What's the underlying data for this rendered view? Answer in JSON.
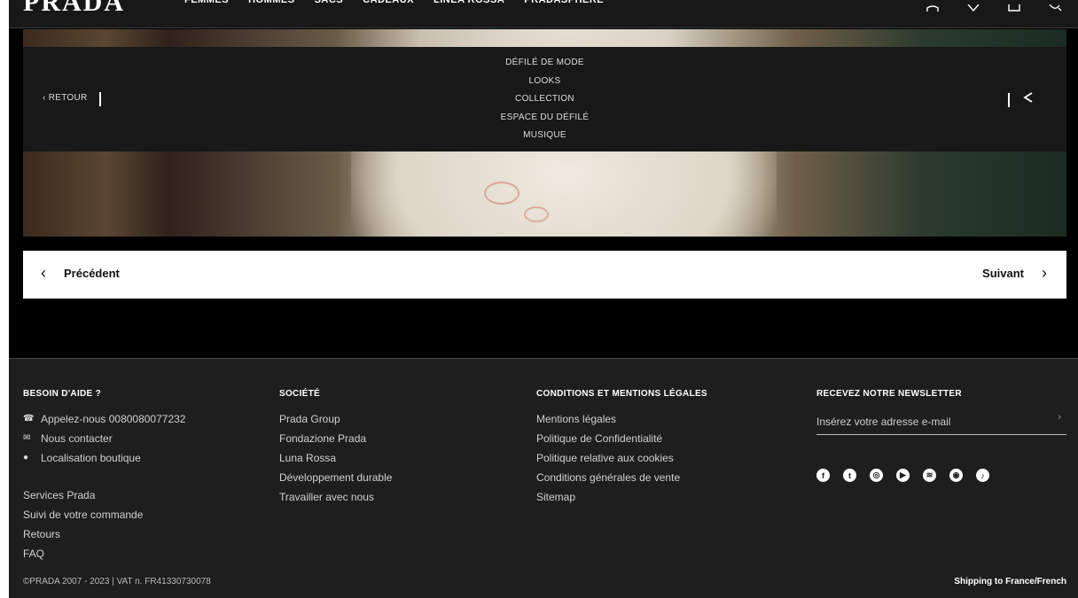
{
  "header": {
    "logo": "PRADA",
    "nav": [
      "FEMMES",
      "HOMMES",
      "SACS",
      "CADEAUX",
      "LINEA ROSSA",
      "PRADASPHERE"
    ]
  },
  "submenu": {
    "back_label": "‹ RETOUR",
    "items": [
      "DÉFILÉ DE MODE",
      "LOOKS",
      "COLLECTION",
      "ESPACE DU DÉFILÉ",
      "MUSIQUE"
    ],
    "share_icon": "share-icon"
  },
  "pager": {
    "prev_label": "Précédent",
    "next_label": "Suivant"
  },
  "footer": {
    "help": {
      "title": "BESOIN D'AIDE ?",
      "contact_items": [
        {
          "icon": "phone-icon",
          "label": "Appelez-nous 0080080077232"
        },
        {
          "icon": "mail-icon",
          "label": "Nous contacter"
        },
        {
          "icon": "pin-icon",
          "label": "Localisation boutique"
        }
      ],
      "links": [
        "Services Prada",
        "Suivi de votre commande",
        "Retours",
        "FAQ"
      ]
    },
    "company": {
      "title": "SOCIÉTÉ",
      "links": [
        "Prada Group",
        "Fondazione Prada",
        "Luna Rossa",
        "Développement durable",
        "Travailler avec nous"
      ]
    },
    "legal": {
      "title": "CONDITIONS ET MENTIONS LÉGALES",
      "links": [
        "Mentions légales",
        "Politique de Confidentialité",
        "Politique relative aux cookies",
        "Conditions générales de vente",
        "Sitemap"
      ]
    },
    "newsletter": {
      "title": "RECEVEZ NOTRE NEWSLETTER",
      "placeholder": "Insérez votre adresse e-mail",
      "social": [
        "facebook-icon",
        "twitter-icon",
        "instagram-icon",
        "youtube-icon",
        "spotify-icon",
        "discord-icon",
        "tiktok-icon"
      ]
    },
    "copyright": "©PRADA 2007 - 2023 | VAT n. FR41330730078",
    "shipping": "Shipping to France/French"
  }
}
